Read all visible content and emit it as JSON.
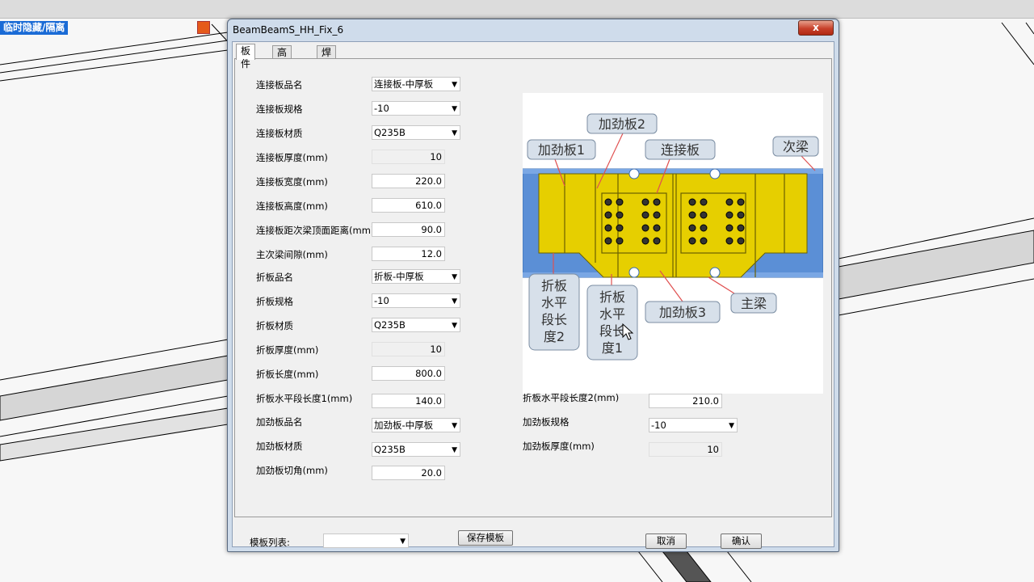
{
  "background": {
    "hide_label": "临时隐藏/隔离"
  },
  "dialog": {
    "title": "BeamBeamS_HH_Fix_6",
    "close_glyph": "x",
    "tabs": [
      {
        "label": "板件"
      },
      {
        "label": "高强螺栓"
      },
      {
        "label": "焊缝"
      }
    ]
  },
  "form": {
    "conn_plate_name": {
      "label": "连接板品名",
      "value": "连接板-中厚板"
    },
    "conn_plate_spec": {
      "label": "连接板规格",
      "value": "-10"
    },
    "conn_plate_mat": {
      "label": "连接板材质",
      "value": "Q235B"
    },
    "conn_plate_thick": {
      "label": "连接板厚度(mm)",
      "value": "10"
    },
    "conn_plate_width": {
      "label": "连接板宽度(mm)",
      "value": "220.0"
    },
    "conn_plate_height": {
      "label": "连接板高度(mm)",
      "value": "610.0"
    },
    "conn_plate_dist": {
      "label": "连接板距次梁顶面距离(mm)",
      "value": "90.0"
    },
    "beam_gap": {
      "label": "主次梁间隙(mm)",
      "value": "12.0"
    },
    "fold_name": {
      "label": "折板品名",
      "value": "折板-中厚板"
    },
    "fold_spec": {
      "label": "折板规格",
      "value": "-10"
    },
    "fold_mat": {
      "label": "折板材质",
      "value": "Q235B"
    },
    "fold_thick": {
      "label": "折板厚度(mm)",
      "value": "10"
    },
    "fold_len": {
      "label": "折板长度(mm)",
      "value": "800.0"
    },
    "fold_h1": {
      "label": "折板水平段长度1(mm)",
      "value": "140.0"
    },
    "fold_h2": {
      "label": "折板水平段长度2(mm)",
      "value": "210.0"
    },
    "stiff_name": {
      "label": "加劲板品名",
      "value": "加劲板-中厚板"
    },
    "stiff_spec": {
      "label": "加劲板规格",
      "value": "-10"
    },
    "stiff_mat": {
      "label": "加劲板材质",
      "value": "Q235B"
    },
    "stiff_thick": {
      "label": "加劲板厚度(mm)",
      "value": "10"
    },
    "stiff_chamfer": {
      "label": "加劲板切角(mm)",
      "value": "20.0"
    }
  },
  "diagram": {
    "callouts": {
      "stiffener1": "加劲板1",
      "stiffener2": "加劲板2",
      "conn_plate": "连接板",
      "secondary_beam": "次梁",
      "fold_len2_l1": "折板",
      "fold_len2_l2": "水平",
      "fold_len2_l3": "段长",
      "fold_len2_l4": "度2",
      "fold_len1_l1": "折板",
      "fold_len1_l2": "水平",
      "fold_len1_l3": "段长",
      "fold_len1_l4": "度1",
      "stiffener3": "加劲板3",
      "main_beam": "主梁"
    },
    "colors": {
      "plate": "#e6cf00",
      "beam": "#5b8fd6",
      "callout_bg": "#d7e0ea",
      "leader": "#e05050"
    }
  },
  "footer": {
    "template_list_label": "模板列表:",
    "template_list_value": "",
    "save_template": "保存模板",
    "cancel": "取消",
    "ok": "确认"
  }
}
